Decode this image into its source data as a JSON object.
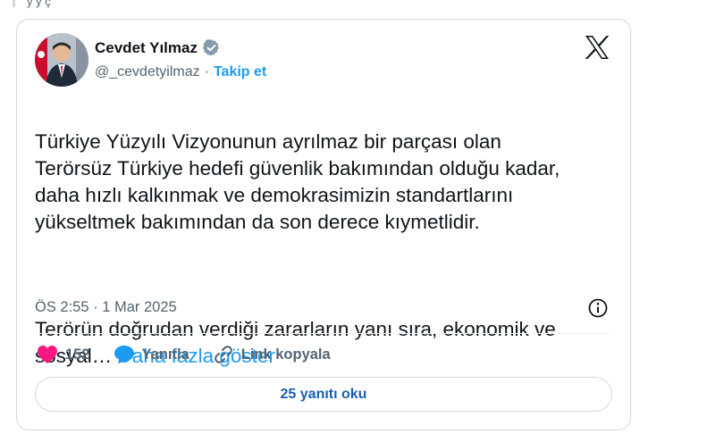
{
  "top_fragment": "y y ç",
  "author": {
    "name": "Cevdet Yılmaz",
    "handle": "@_cevdetyilmaz",
    "follow_label": "Takip et"
  },
  "tweet": {
    "paragraph_1": "Türkiye Yüzyılı Vizyonunun ayrılmaz bir parçası olan\nTerörsüz Türkiye hedefi güvenlik bakımından olduğu kadar,\ndaha hızlı kalkınmak ve demokrasimizin standartlarını\nyükseltmek bakımından da son derece kıymetlidir.",
    "paragraph_2": "Terörün doğrudan verdiği zararların yanı sıra, ekonomik ve\nsosyal…",
    "show_more": "Daha fazla göster",
    "timestamp": "ÖS 2:55 · 1 Mar 2025"
  },
  "actions": {
    "likes": "152",
    "reply_label": "Yanıtla",
    "copy_link_label": "Link kopyala"
  },
  "read_replies_label": "25 yanıtı oku",
  "colors": {
    "accent": "#1d9bf0",
    "like": "#f91880",
    "text": "#0f1419",
    "muted": "#536471",
    "border": "#cfd9de"
  }
}
